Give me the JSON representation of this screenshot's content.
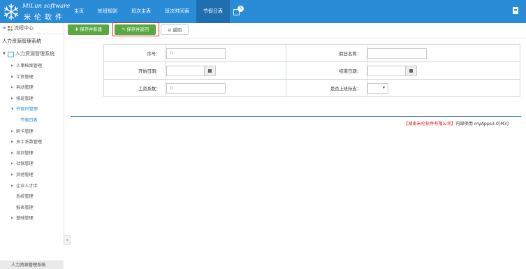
{
  "header": {
    "logo_en": "MiLun software",
    "logo_cn": "米伦软件",
    "nav": [
      {
        "label": "主页"
      },
      {
        "label": "轮班规则"
      },
      {
        "label": "班次主表"
      },
      {
        "label": "班次时间表"
      },
      {
        "label": "节假日表",
        "active": true
      }
    ],
    "badge_count": "5"
  },
  "sidebar": {
    "flow_center": "流程中心",
    "system_title": "人力资源管理系统",
    "system_sub": "人力资源管理系统",
    "items": [
      {
        "label": "人事档案管理"
      },
      {
        "label": "工资管理"
      },
      {
        "label": "异动管理"
      },
      {
        "label": "排班管理"
      },
      {
        "label": "节假日管理"
      },
      {
        "label": "节假日表"
      },
      {
        "label": "刷卡管理"
      },
      {
        "label": "员工系数管理"
      },
      {
        "label": "培训管理"
      },
      {
        "label": "社保管理"
      },
      {
        "label": "其他管理"
      },
      {
        "label": "企业人才库"
      },
      {
        "label": "系统管理"
      },
      {
        "label": "报表管理"
      },
      {
        "label": "基础管理"
      }
    ],
    "bottom": "人力资源管理系统"
  },
  "toolbar": {
    "save_new": "保存并新建",
    "save_return": "保存并返回",
    "back": "返回"
  },
  "form": {
    "seq_label": "序号：",
    "seq_value": "0",
    "holiday_name_label": "假日名称：",
    "holiday_name_value": "",
    "start_date_label": "开始日期：",
    "start_date_value": "",
    "end_date_label": "结束日期：",
    "end_date_value": "",
    "wage_coef_label": "工资系数：",
    "wage_coef_value": "0",
    "is_workday_label": "是否上班标志：",
    "is_workday_value": ""
  },
  "footer": {
    "company": "【湖南米伦软件有限公司】",
    "suffix": "内部使用 myApps3.0[M3]"
  },
  "colors": {
    "primary": "#2a8bd6",
    "green": "#5aa840",
    "highlight": "#d9352e"
  }
}
